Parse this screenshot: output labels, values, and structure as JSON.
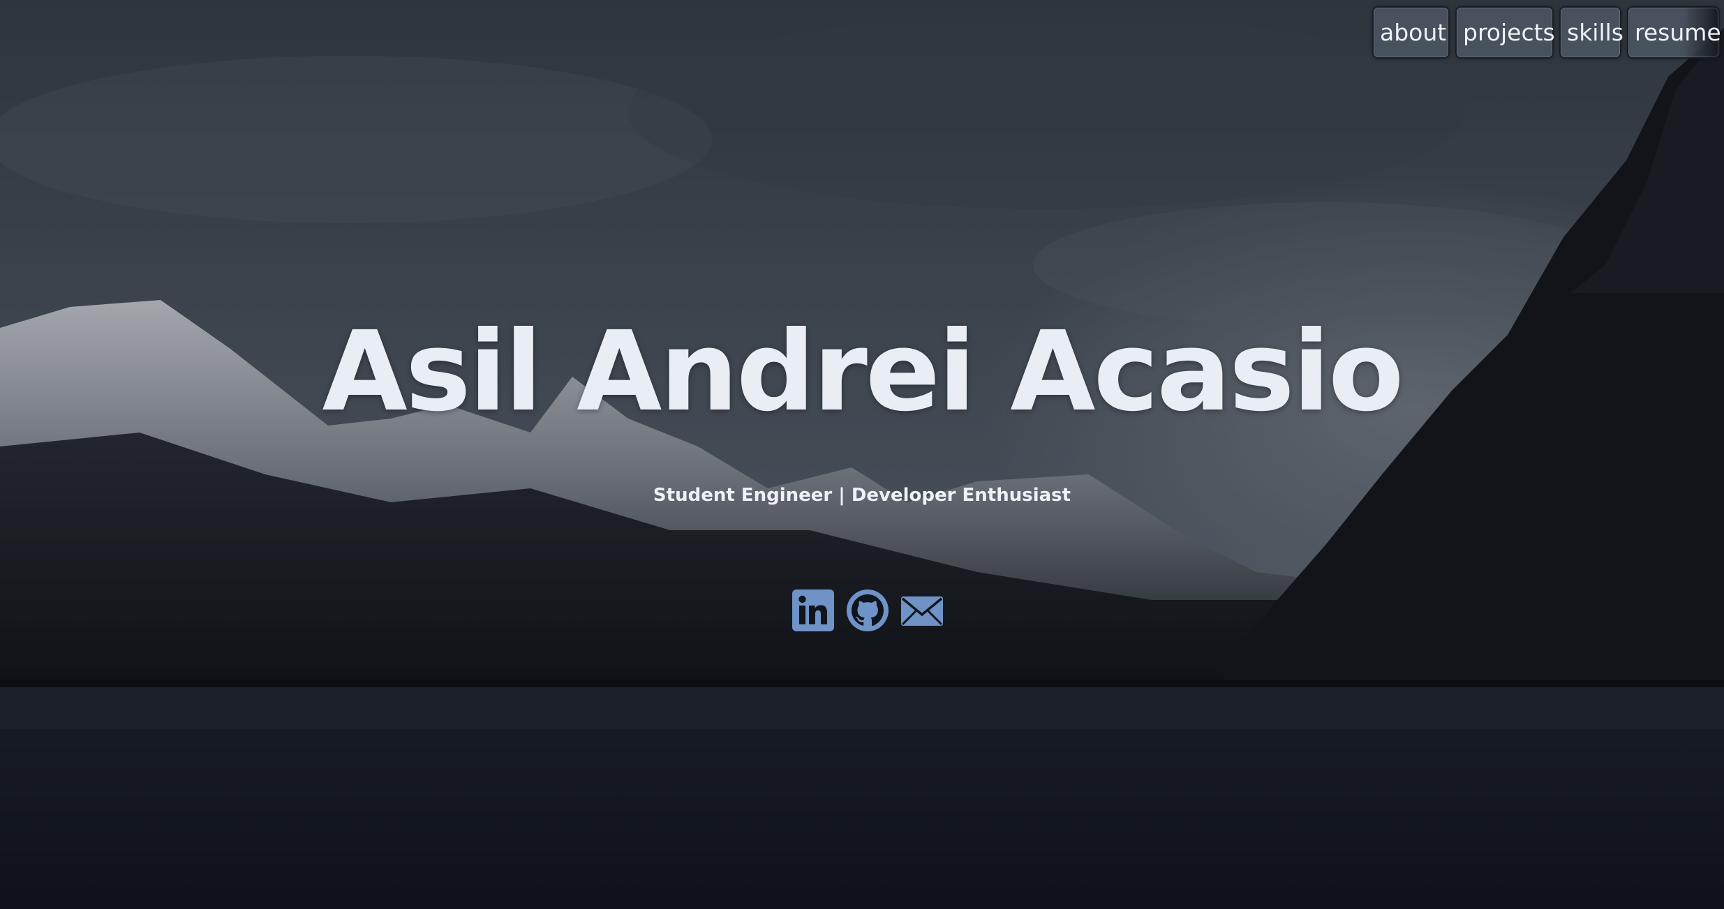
{
  "nav": {
    "items": [
      {
        "label": "about"
      },
      {
        "label": "projects"
      },
      {
        "label": "skills"
      },
      {
        "label": "resume"
      }
    ]
  },
  "hero": {
    "title": "Asil Andrei Acasio",
    "subtitle": "Student Engineer | Developer Enthusiast"
  },
  "social": {
    "icons": [
      "linkedin-icon",
      "github-icon",
      "email-icon"
    ],
    "color": "#6f93c7"
  },
  "colors": {
    "text": "#e9edf4",
    "nav_bg": "#4e5864",
    "icon_accent": "#6f93c7"
  }
}
